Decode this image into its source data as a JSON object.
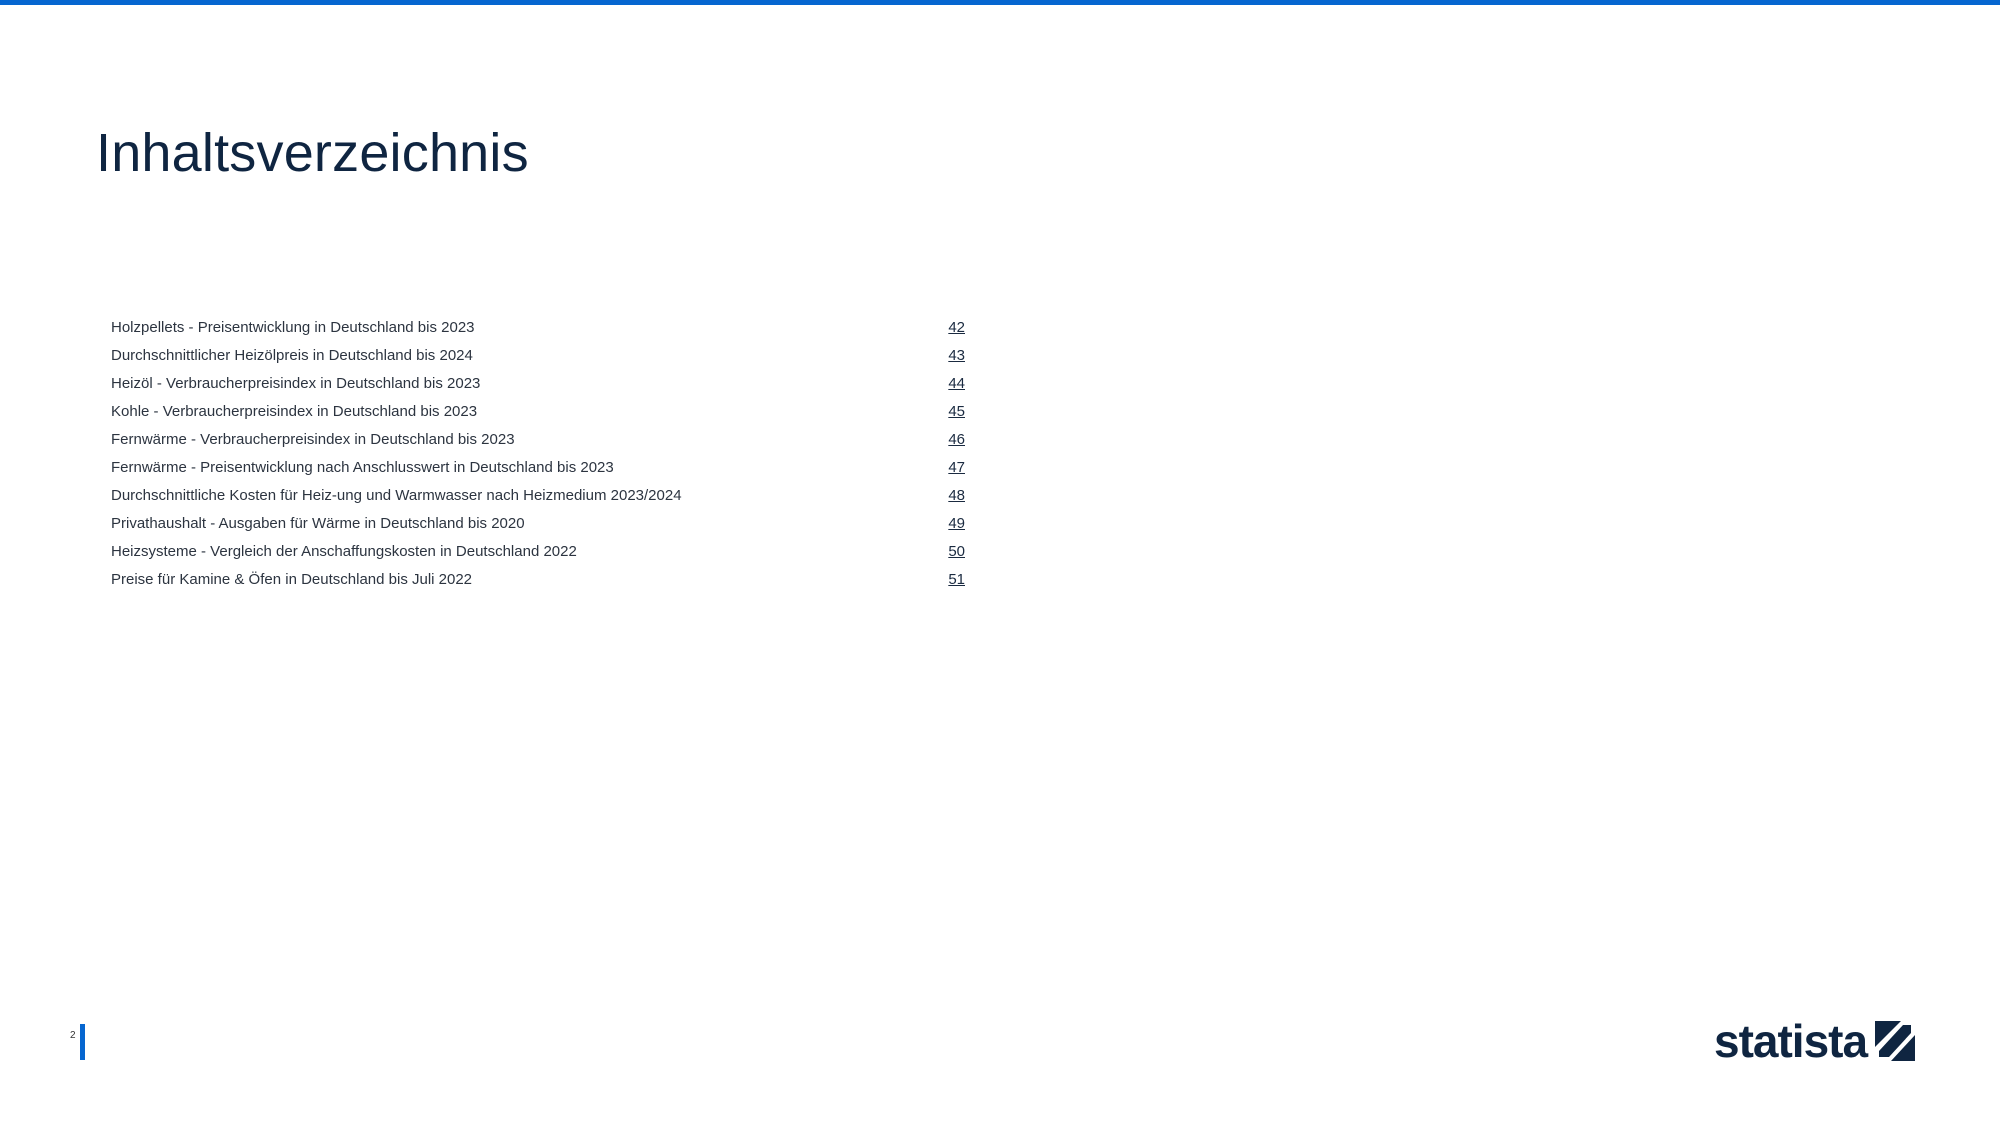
{
  "title": "Inhaltsverzeichnis",
  "toc": [
    {
      "label": "Holzpellets - Preisentwicklung in Deutschland bis 2023",
      "page": "42"
    },
    {
      "label": "Durchschnittlicher Heizölpreis in Deutschland bis 2024",
      "page": "43"
    },
    {
      "label": "Heizöl - Verbraucherpreisindex in Deutschland bis 2023",
      "page": "44"
    },
    {
      "label": "Kohle - Verbraucherpreisindex in Deutschland bis 2023",
      "page": "45"
    },
    {
      "label": "Fernwärme - Verbraucherpreisindex in Deutschland bis 2023",
      "page": "46"
    },
    {
      "label": "Fernwärme - Preisentwicklung nach Anschlusswert in Deutschland bis 2023",
      "page": "47"
    },
    {
      "label": "Durchschnittliche Kosten für Heiz-ung und Warmwasser nach Heizmedium 2023/2024",
      "page": "48"
    },
    {
      "label": "Privathaushalt - Ausgaben für Wärme in Deutschland bis 2020",
      "page": "49"
    },
    {
      "label": "Heizsysteme - Vergleich der Anschaffungskosten in Deutschland 2022",
      "page": "50"
    },
    {
      "label": "Preise für Kamine & Öfen in Deutschland bis Juli 2022",
      "page": "51"
    }
  ],
  "footer": {
    "page_number": "2"
  },
  "logo": {
    "text": "statista",
    "icon": "statista-logo-icon"
  },
  "colors": {
    "accent": "#0666d0",
    "title": "#0f2541"
  }
}
